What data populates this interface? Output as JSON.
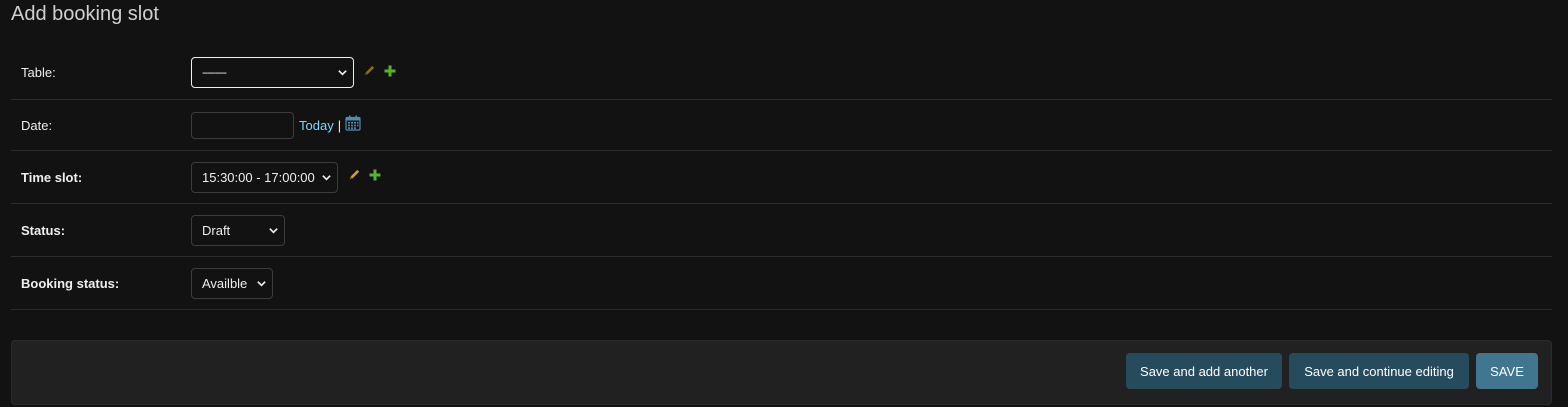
{
  "page": {
    "title": "Add booking slot"
  },
  "form": {
    "table": {
      "label": "Table:",
      "value": "---------",
      "edit_icon": "pencil-icon",
      "add_icon": "plus-icon"
    },
    "date": {
      "label": "Date:",
      "value": "",
      "today_link": "Today",
      "separator": "|",
      "calendar_icon": "calendar-icon"
    },
    "time_slot": {
      "label": "Time slot:",
      "value": "15:30:00 - 17:00:00",
      "edit_icon": "pencil-icon",
      "add_icon": "plus-icon"
    },
    "status": {
      "label": "Status:",
      "value": "Draft"
    },
    "booking_status": {
      "label": "Booking status:",
      "value": "Availble"
    }
  },
  "submit": {
    "save_add_another": "Save and add another",
    "save_continue": "Save and continue editing",
    "save": "SAVE"
  },
  "colors": {
    "background": "#121212",
    "panel": "#212121",
    "link": "#81d4fa",
    "button_primary": "#417690",
    "button_secondary": "#264b5d",
    "edit_icon": "#c9a227",
    "add_icon": "#5ab031"
  }
}
